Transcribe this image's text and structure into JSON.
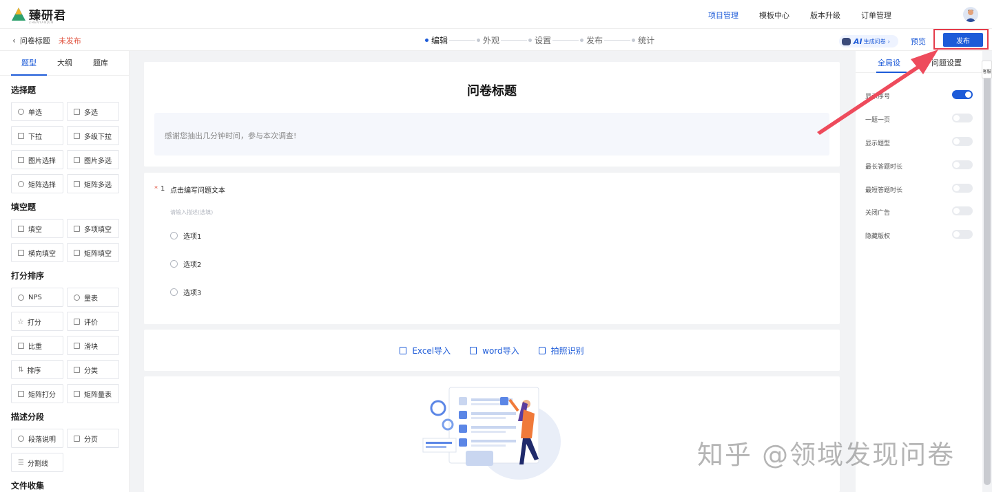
{
  "app": {
    "logo_text": "臻研君",
    "logo_sub": "ZHENYANJUN"
  },
  "topnav": [
    "项目管理",
    "模板中心",
    "版本升级",
    "订单管理"
  ],
  "subbar": {
    "back_label": "问卷标题",
    "status": "未发布",
    "steps": [
      "编辑",
      "外观",
      "设置",
      "发布",
      "统计"
    ],
    "ai_label": "生成问卷",
    "ai_prefix": "AI",
    "preview_label": "预览",
    "publish_label": "发布"
  },
  "left": {
    "tabs": [
      "题型",
      "大纲",
      "题库"
    ],
    "sections": {
      "choice": "选择题",
      "fill": "填空题",
      "score": "打分排序",
      "desc": "描述分段",
      "file": "文件收集"
    },
    "choice_items": [
      "单选",
      "多选",
      "下拉",
      "多级下拉",
      "图片选择",
      "图片多选",
      "矩阵选择",
      "矩阵多选"
    ],
    "fill_items": [
      "填空",
      "多项填空",
      "横向填空",
      "矩阵填空"
    ],
    "score_items": [
      "NPS",
      "量表",
      "打分",
      "评价",
      "比重",
      "滑块",
      "排序",
      "分类",
      "矩阵打分",
      "矩阵量表"
    ],
    "desc_items": [
      "段落说明",
      "分页",
      "分割线"
    ]
  },
  "survey": {
    "title": "问卷标题",
    "description": "感谢您抽出几分钟时间，参与本次调查!",
    "question": {
      "number": "1",
      "required_mark": "*",
      "text": "点击编写问题文本",
      "hint": "请输入描述(选填)",
      "options": [
        "选项1",
        "选项2",
        "选项3"
      ]
    },
    "imports": [
      "Excel导入",
      "word导入",
      "拍照识别"
    ]
  },
  "right": {
    "tabs": [
      "全局设",
      "问题设置"
    ],
    "settings": [
      {
        "label": "显示序号",
        "on": true
      },
      {
        "label": "一题一页",
        "on": false
      },
      {
        "label": "显示题型",
        "on": false
      },
      {
        "label": "最长答题时长",
        "on": false
      },
      {
        "label": "最短答题时长",
        "on": false
      },
      {
        "label": "关闭广告",
        "on": false
      },
      {
        "label": "隐藏版权",
        "on": false
      }
    ],
    "side_tag": "客服"
  },
  "watermark": "知乎 @领域发现问卷",
  "colors": {
    "accent": "#1d5bd8",
    "highlight": "#e53b4a",
    "unpublished": "#e0503c"
  }
}
